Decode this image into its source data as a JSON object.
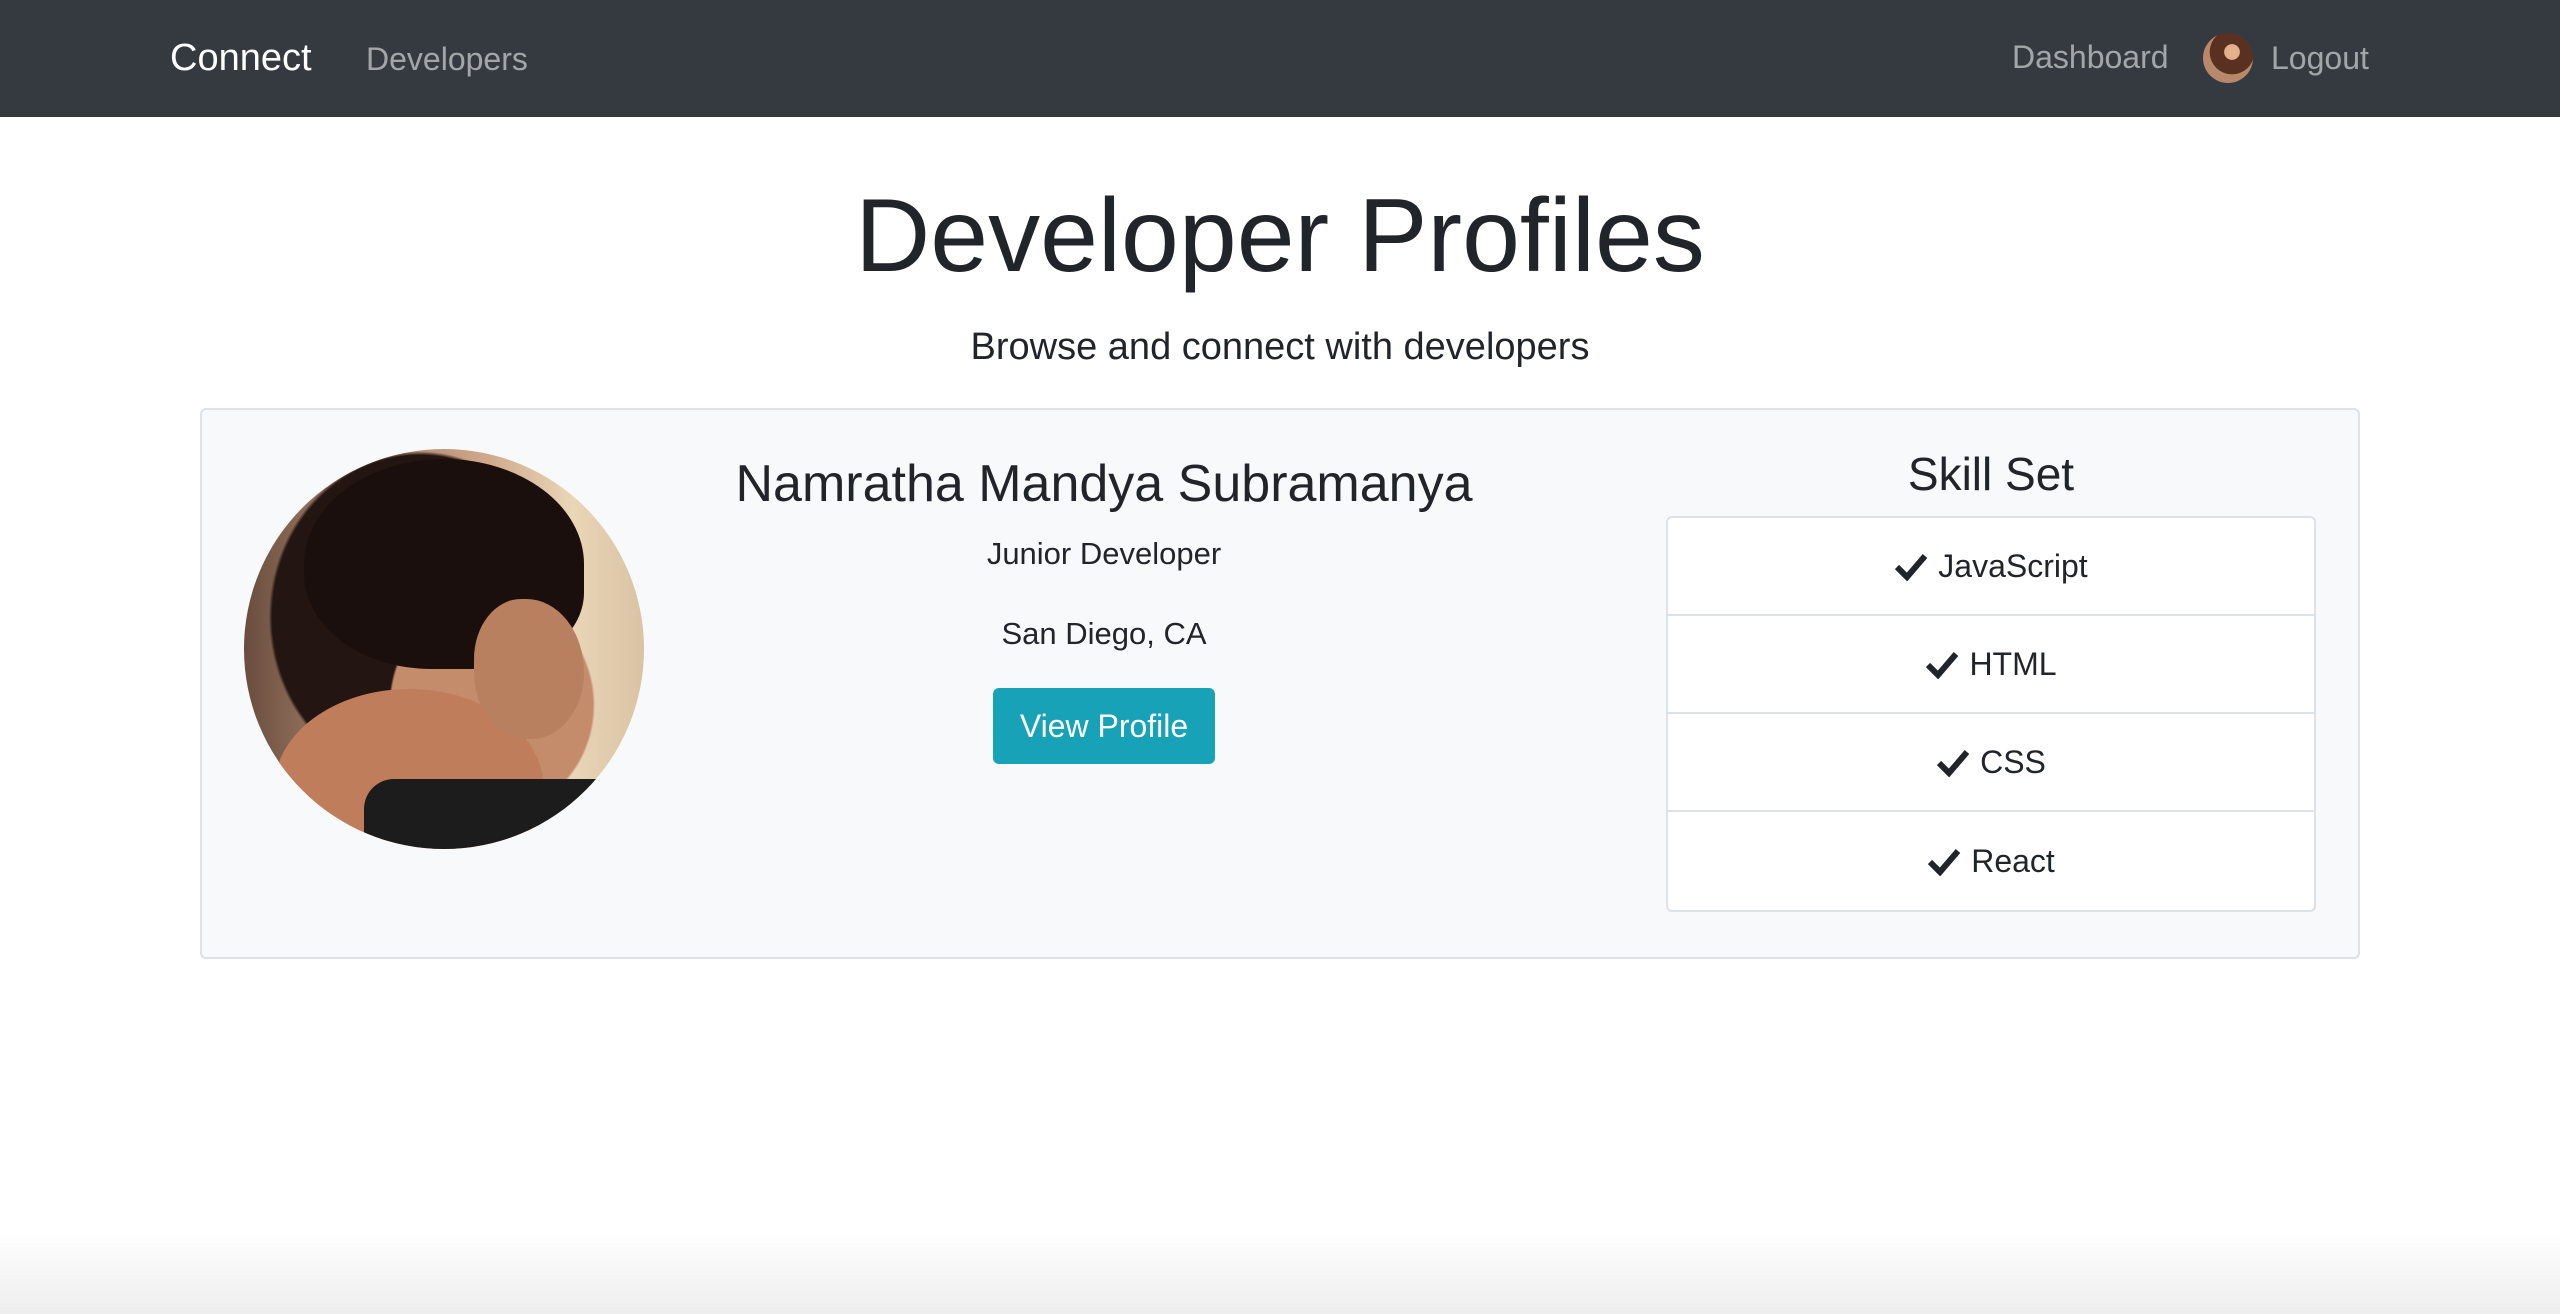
{
  "navbar": {
    "brand": "Connect",
    "developers_link": "Developers",
    "dashboard_link": "Dashboard",
    "logout_link": "Logout"
  },
  "hero": {
    "title": "Developer Profiles",
    "subtitle": "Browse and connect with developers"
  },
  "profile": {
    "name": "Namratha Mandya Subramanya",
    "status": "Junior Developer",
    "location": "San Diego, CA",
    "button_label": "View Profile"
  },
  "skills": {
    "title": "Skill Set",
    "items": [
      "JavaScript",
      "HTML",
      "CSS",
      "React"
    ]
  },
  "colors": {
    "navbar": "#343a40",
    "accent_button": "#17a2b8",
    "card_background": "#f8f9fa"
  }
}
